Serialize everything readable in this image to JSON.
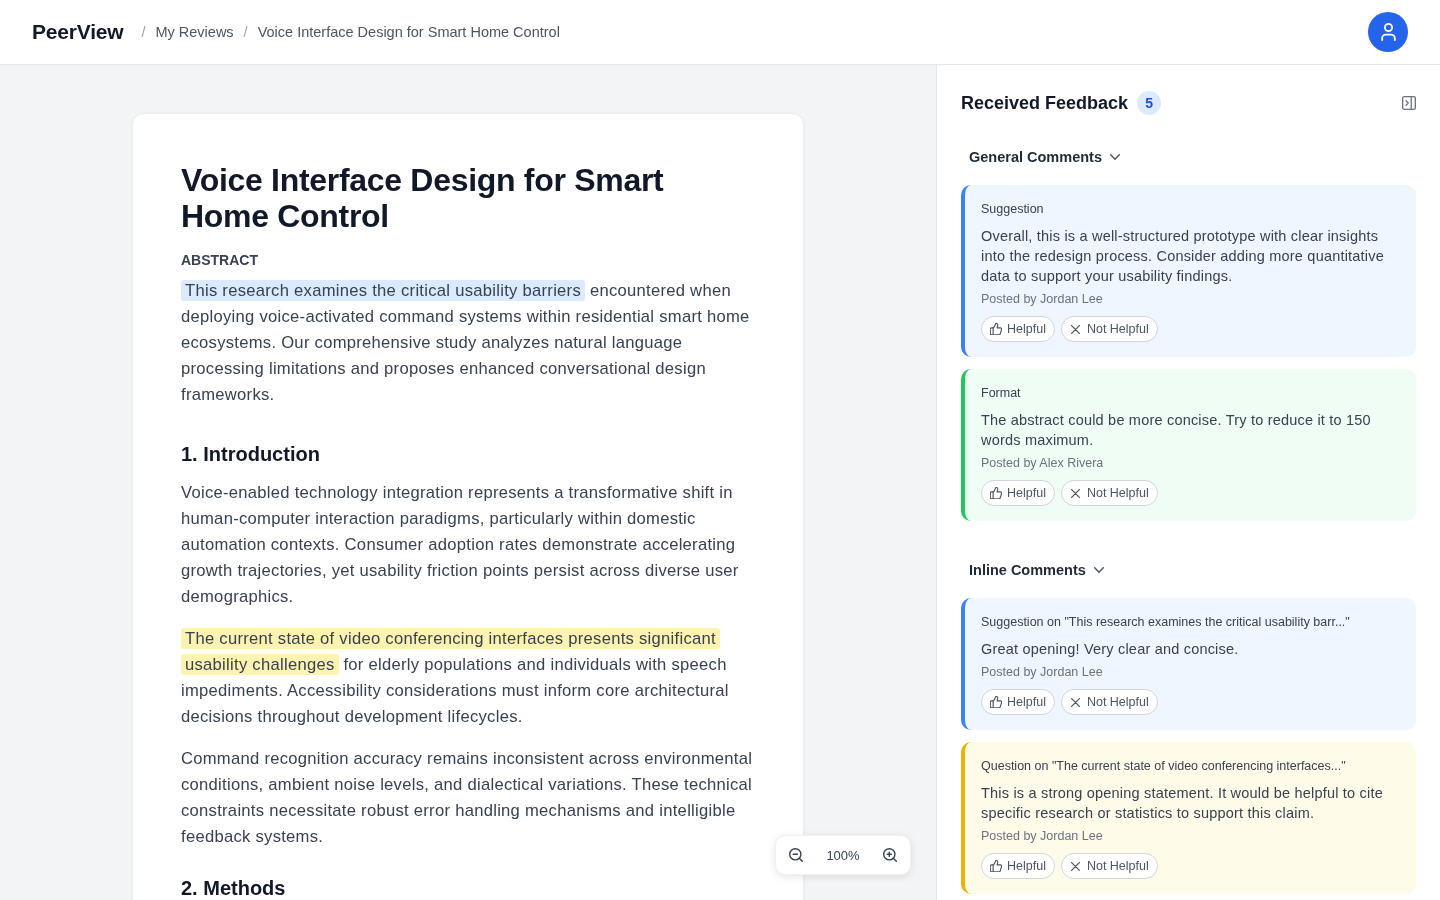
{
  "header": {
    "logo": "PeerView",
    "breadcrumb": [
      {
        "separator": "/",
        "label": "My Reviews"
      },
      {
        "separator": "/",
        "label": "Voice Interface Design for Smart Home Control"
      }
    ]
  },
  "document": {
    "title": "Voice Interface Design for Smart Home Control",
    "abstract_label": "ABSTRACT",
    "abstract": [
      {
        "kind": "suggestion",
        "text": "This research examines the critical usability barriers"
      },
      {
        "kind": "plain",
        "text": " encountered when deploying voice-activated command systems within residential smart home ecosystems. Our comprehensive study analyzes natural language processing limitations and proposes enhanced conversational design frameworks."
      }
    ],
    "sections": [
      {
        "heading": "1. Introduction",
        "paragraphs": [
          [
            {
              "kind": "plain",
              "text": "Voice-enabled technology integration represents a transformative shift in human-computer interaction paradigms, particularly within domestic automation contexts. Consumer adoption rates demonstrate accelerating growth trajectories, yet usability friction points persist across diverse user demographics."
            }
          ],
          [
            {
              "kind": "question",
              "text": "The current state of video conferencing interfaces presents significant usability challenges"
            },
            {
              "kind": "plain",
              "text": " for elderly populations and individuals with speech impediments. Accessibility considerations must inform core architectural decisions throughout development lifecycles."
            }
          ],
          [
            {
              "kind": "plain",
              "text": "Command recognition accuracy remains inconsistent across environmental conditions, ambient noise levels, and dialectical variations. These technical constraints necessitate robust error handling mechanisms and intelligible feedback systems."
            }
          ]
        ]
      },
      {
        "heading": "2. Methods"
      }
    ]
  },
  "zoom": {
    "label": "100%"
  },
  "feedback": {
    "title": "Received Feedback",
    "count": "5",
    "sections": [
      {
        "title": "General Comments",
        "expanded": true,
        "comments": [
          {
            "kind": "suggestion",
            "label": "Suggestion",
            "body": "Overall, this is a well-structured prototype with clear insights into the redesign process. Consider adding more quantitative data to support your usability findings.",
            "author": "Posted by Jordan Lee",
            "actions": [
              {
                "kind": "helpful",
                "label": "Helpful"
              },
              {
                "kind": "not_helpful",
                "label": "Not Helpful"
              }
            ]
          },
          {
            "kind": "format",
            "label": "Format",
            "body": "The abstract could be more concise. Try to reduce it to 150 words maximum.",
            "author": "Posted by Alex Rivera",
            "actions": [
              {
                "kind": "helpful",
                "label": "Helpful"
              },
              {
                "kind": "not_helpful",
                "label": "Not Helpful"
              }
            ]
          }
        ]
      },
      {
        "title": "Inline Comments",
        "expanded": true,
        "comments": [
          {
            "kind": "suggestion",
            "label": "Suggestion on \"This research examines the critical usability barr...\"",
            "body": "Great opening! Very clear and concise.",
            "author": "Posted by Jordan Lee",
            "actions": [
              {
                "kind": "helpful",
                "label": "Helpful"
              },
              {
                "kind": "not_helpful",
                "label": "Not Helpful"
              }
            ]
          },
          {
            "kind": "question",
            "label": "Question on \"The current state of video conferencing interfaces...\"",
            "body": "This is a strong opening statement. It would be helpful to cite specific research or statistics to support this claim.",
            "author": "Posted by Jordan Lee",
            "actions": [
              {
                "kind": "helpful",
                "label": "Helpful"
              },
              {
                "kind": "not_helpful",
                "label": "Not Helpful"
              }
            ]
          }
        ]
      }
    ]
  }
}
